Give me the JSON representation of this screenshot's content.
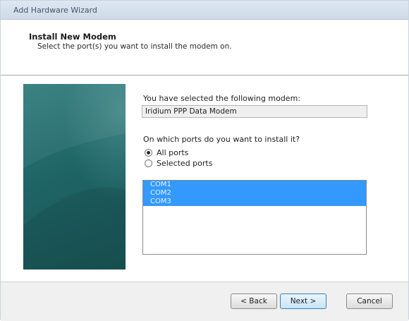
{
  "window": {
    "title": "Add Hardware Wizard"
  },
  "header": {
    "title": "Install New Modem",
    "subtitle": "Select the port(s) you want to install the modem on."
  },
  "content": {
    "selected_modem_label": "You have selected the following modem:",
    "selected_modem_value": "Iridium PPP Data Modem",
    "ports_question": "On which ports do you want to install it?",
    "radio_all_ports": "All ports",
    "radio_selected_ports": "Selected ports",
    "radio_selected": "all_ports",
    "ports": [
      "COM1",
      "COM2",
      "COM3"
    ]
  },
  "buttons": {
    "back": "< Back",
    "next": "Next >",
    "cancel": "Cancel"
  },
  "colors": {
    "banner": "#1f6566",
    "selection": "#3399ff",
    "window_bg": "#f0f0f0"
  }
}
